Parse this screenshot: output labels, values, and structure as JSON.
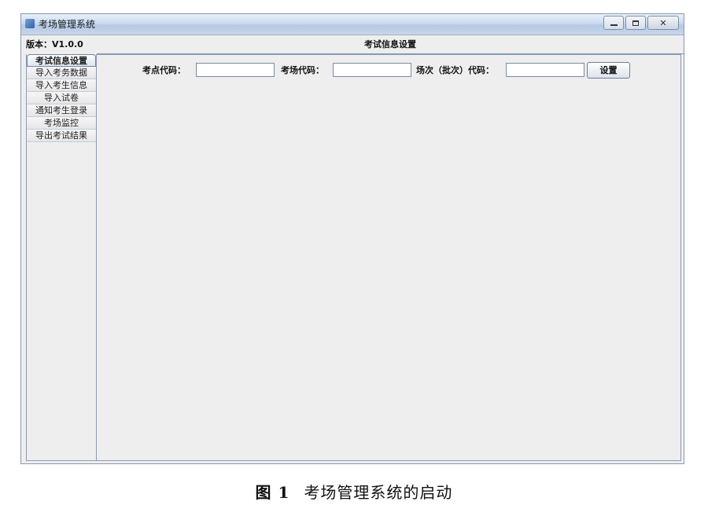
{
  "window": {
    "title": "考场管理系统",
    "app_icon": "app-icon",
    "controls": [
      "minimize-icon",
      "maximize-icon",
      "close-icon"
    ]
  },
  "version_label": "版本：V1.0.0",
  "panel_title": "考试信息设置",
  "sidebar": {
    "items": [
      {
        "label": "考试信息设置",
        "active": true
      },
      {
        "label": "导入考务数据",
        "active": false
      },
      {
        "label": "导入考生信息",
        "active": false
      },
      {
        "label": "导入试卷",
        "active": false
      },
      {
        "label": "通知考生登录",
        "active": false
      },
      {
        "label": "考场监控",
        "active": false
      },
      {
        "label": "导出考试结果",
        "active": false
      }
    ]
  },
  "form": {
    "site_code_label": "考点代码：",
    "site_code_value": "",
    "room_code_label": "考场代码：",
    "room_code_value": "",
    "session_code_label": "场次（批次）代码：",
    "session_code_value": "",
    "submit_label": "设置"
  },
  "caption": {
    "figure_number": "图 1",
    "text": "考场管理系统的启动"
  }
}
